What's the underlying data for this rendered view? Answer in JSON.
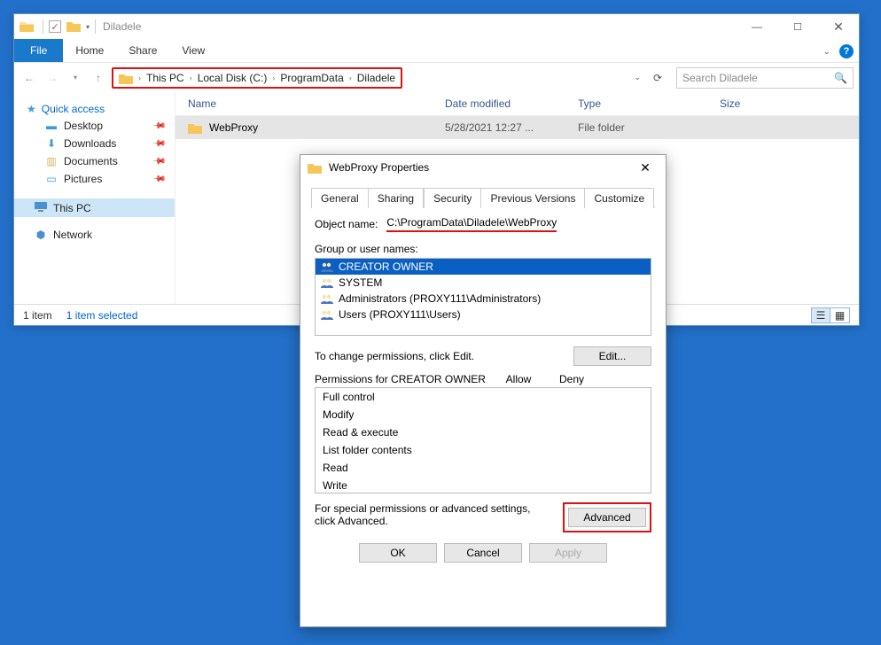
{
  "explorer": {
    "title": "Diladele",
    "ribbon": {
      "file": "File",
      "home": "Home",
      "share": "Share",
      "view": "View"
    },
    "breadcrumb": [
      "This PC",
      "Local Disk (C:)",
      "ProgramData",
      "Diladele"
    ],
    "search_placeholder": "Search Diladele",
    "columns": {
      "name": "Name",
      "date": "Date modified",
      "type": "Type",
      "size": "Size"
    },
    "rows": [
      {
        "name": "WebProxy",
        "date": "5/28/2021 12:27 ...",
        "type": "File folder",
        "size": ""
      }
    ],
    "sidebar": {
      "quick": "Quick access",
      "items": [
        {
          "label": "Desktop"
        },
        {
          "label": "Downloads"
        },
        {
          "label": "Documents"
        },
        {
          "label": "Pictures"
        }
      ],
      "thispc": "This PC",
      "network": "Network"
    },
    "status": {
      "count": "1 item",
      "selected": "1 item selected"
    }
  },
  "dialog": {
    "title": "WebProxy Properties",
    "tabs": {
      "general": "General",
      "sharing": "Sharing",
      "security": "Security",
      "previous": "Previous Versions",
      "customize": "Customize"
    },
    "object_label": "Object name:",
    "object_path": "C:\\ProgramData\\Diladele\\WebProxy",
    "group_label": "Group or user names:",
    "users": [
      "CREATOR OWNER",
      "SYSTEM",
      "Administrators (PROXY111\\Administrators)",
      "Users (PROXY111\\Users)"
    ],
    "change_text": "To change permissions, click Edit.",
    "edit_btn": "Edit...",
    "perm_for": "Permissions for CREATOR OWNER",
    "allow": "Allow",
    "deny": "Deny",
    "perms": [
      "Full control",
      "Modify",
      "Read & execute",
      "List folder contents",
      "Read",
      "Write"
    ],
    "adv_text": "For special permissions or advanced settings, click Advanced.",
    "adv_btn": "Advanced",
    "ok": "OK",
    "cancel": "Cancel",
    "apply": "Apply"
  }
}
